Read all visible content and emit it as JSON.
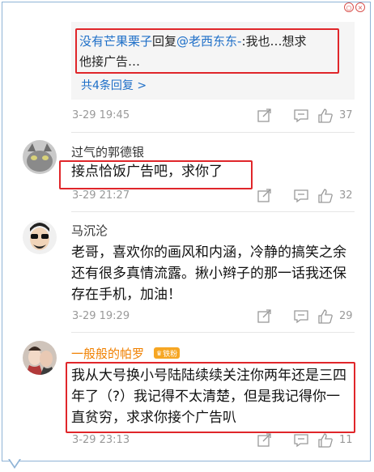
{
  "window": {
    "close_glyph": "×",
    "min_glyph": "○"
  },
  "reply_preview": {
    "user": "没有芒果栗子",
    "verb": "回复",
    "mention": "@老西东东-",
    "text_line1": ":我也…想求",
    "text_line2": "他接广告…",
    "more_link": "共4条回复 >"
  },
  "comments": [
    {
      "date": "3-29 19:45",
      "likes": "37"
    },
    {
      "username": "过气的郭德银",
      "text": "接点恰饭广告吧，求你了",
      "date": "3-29 21:27",
      "likes": "32"
    },
    {
      "username": "马沉沦",
      "text": "老哥，喜欢你的画风和内涵，冷静的搞笑之余还有很多真情流露。揪小辫子的那一话我还保存在手机，加油！",
      "date": "3-29 19:29",
      "likes": "29"
    },
    {
      "username": "一般般的帕罗",
      "badge": "铁粉",
      "text": "我从大号换小号陆陆续续关注你两年还是三四年了（?）我记得不太清楚，但是我记得你一直贫穷，求求你接个广告叭",
      "date": "3-29 23:13",
      "likes": "11"
    }
  ],
  "icons": {
    "share": "share-icon",
    "comment": "comment-icon",
    "like": "thumbs-up-icon"
  },
  "colors": {
    "link": "#1e6fc8",
    "highlight": "#e0262a",
    "username_fan": "#f08000"
  }
}
